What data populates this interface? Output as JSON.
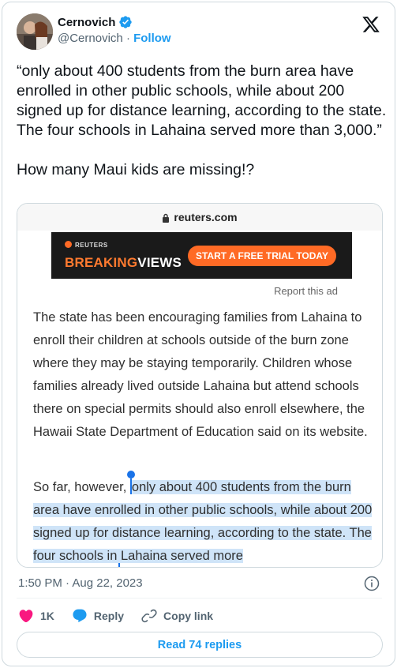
{
  "author": {
    "name": "Cernovich",
    "handle": "@Cernovich",
    "separator": "·",
    "follow_label": "Follow"
  },
  "tweet": {
    "text": "“only about 400 students from the burn area have enrolled in other public schools, while about 200 signed up for distance learning, according to the state. The four schools in Lahaina served more than 3,000.”\n\nHow many Maui kids are missing!?"
  },
  "media": {
    "url": "reuters.com",
    "ad": {
      "brand_small": "REUTERS",
      "brand_breaking": "BREAKING",
      "brand_views": "VIEWS",
      "cta": "START A FREE TRIAL TODAY"
    },
    "report_ad": "Report this ad",
    "paragraph1": "The state has been encouraging families from Lahaina to enroll their children at schools outside of the burn zone where they may be staying temporarily. Children whose families already lived outside Lahaina but attend schools there on special permits should also enroll elsewhere, the Hawaii State Department of Education said on its website.",
    "paragraph2_lead": "So far, however, ",
    "paragraph2_highlight": "only about 400 students from the burn area have enrolled in other public schools, while about 200 signed up for distance learning, according to the state. The four schools in Lahaina served more"
  },
  "meta": {
    "timestamp": "1:50 PM · Aug 22, 2023"
  },
  "actions": {
    "likes": "1K",
    "reply_label": "Reply",
    "copy_label": "Copy link",
    "read_replies": "Read 74 replies"
  },
  "colors": {
    "accent": "#1d9bf0",
    "like": "#f91880",
    "highlight": "#cfe4f8",
    "ad_orange": "#ff6a25"
  }
}
